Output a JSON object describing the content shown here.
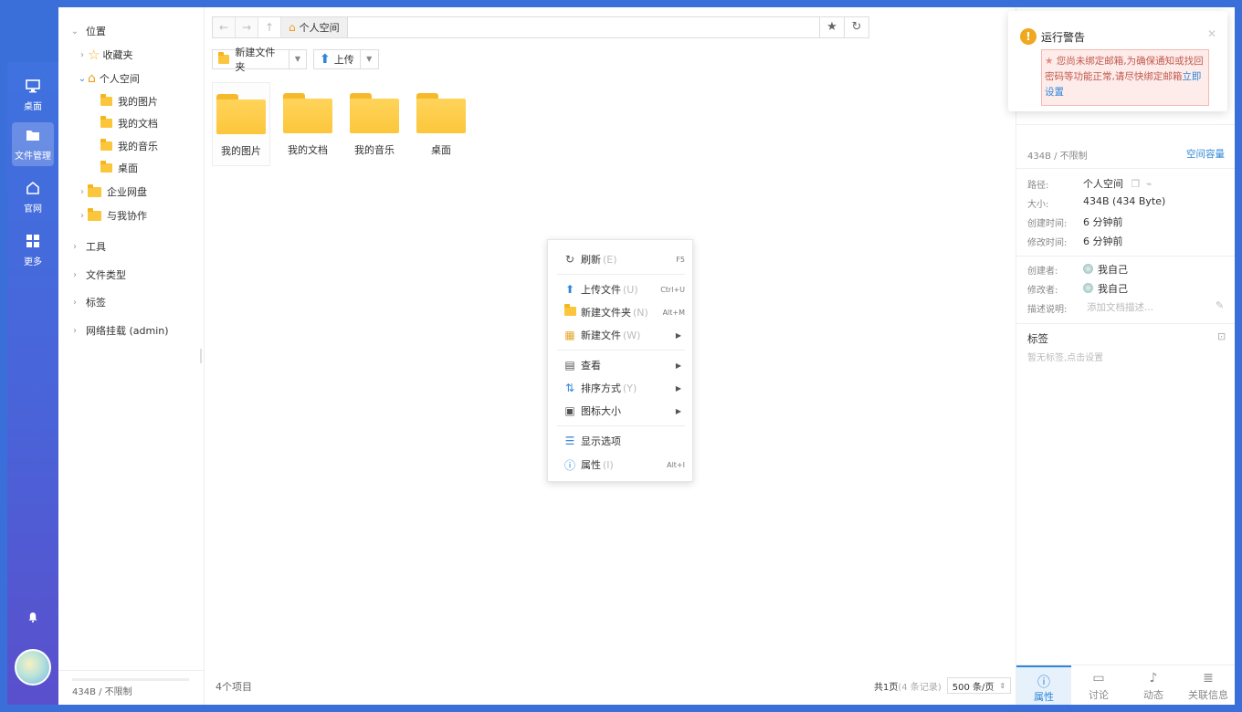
{
  "rail": {
    "items": [
      {
        "label": "桌面",
        "icon": "monitor-icon"
      },
      {
        "label": "文件管理",
        "icon": "folder-icon"
      },
      {
        "label": "官网",
        "icon": "home-icon"
      },
      {
        "label": "更多",
        "icon": "grid-icon"
      }
    ],
    "active_index": 1
  },
  "tree": {
    "location": "位置",
    "favorites": "收藏夹",
    "personal_space": "个人空间",
    "children": [
      "我的图片",
      "我的文档",
      "我的音乐",
      "桌面"
    ],
    "enterprise": "企业网盘",
    "shared": "与我协作",
    "tools": "工具",
    "file_types": "文件类型",
    "tags": "标签",
    "network_mount": "网络挂载 (admin)",
    "storage": "434B / 不限制"
  },
  "addressbar": {
    "crumb": "个人空间"
  },
  "toolbar": {
    "new_folder": "新建文件夹",
    "upload": "上传"
  },
  "folders": [
    "我的图片",
    "我的文档",
    "我的音乐",
    "桌面"
  ],
  "status": {
    "count": "4个项目",
    "pages": "共1页",
    "records": "(4 条记录)",
    "per_page": "500 条/页"
  },
  "context_menu": {
    "refresh": {
      "label": "刷新",
      "hotkey": "(E)",
      "shortcut": "F5"
    },
    "upload": {
      "label": "上传文件",
      "hotkey": "(U)",
      "shortcut": "Ctrl+U"
    },
    "new_folder": {
      "label": "新建文件夹",
      "hotkey": "(N)",
      "shortcut": "Alt+M"
    },
    "new_file": {
      "label": "新建文件",
      "hotkey": "(W)"
    },
    "view": {
      "label": "查看"
    },
    "sort": {
      "label": "排序方式",
      "hotkey": "(Y)"
    },
    "icon_size": {
      "label": "图标大小"
    },
    "display": {
      "label": "显示选项"
    },
    "properties": {
      "label": "属性",
      "hotkey": "(I)",
      "shortcut": "Alt+I"
    }
  },
  "info": {
    "capacity": "434B / 不限制",
    "capacity_link": "空间容量",
    "path_label": "路径:",
    "path": "个人空间",
    "size_label": "大小:",
    "size": "434B (434 Byte)",
    "created_label": "创建时间:",
    "created": "6 分钟前",
    "modified_label": "修改时间:",
    "modified": "6 分钟前",
    "creator_label": "创建者:",
    "creator": "我自己",
    "modifier_label": "修改者:",
    "modifier": "我自己",
    "desc_label": "描述说明:",
    "desc_placeholder": "添加文档描述...",
    "tags_title": "标签",
    "tags_empty": "暂无标签,点击设置",
    "tabs": [
      "属性",
      "讨论",
      "动态",
      "关联信息"
    ]
  },
  "toast": {
    "title": "运行警告",
    "message": "您尚未绑定邮箱,为确保通知或找回密码等功能正常,请尽快绑定邮箱",
    "link": "立即设置"
  }
}
